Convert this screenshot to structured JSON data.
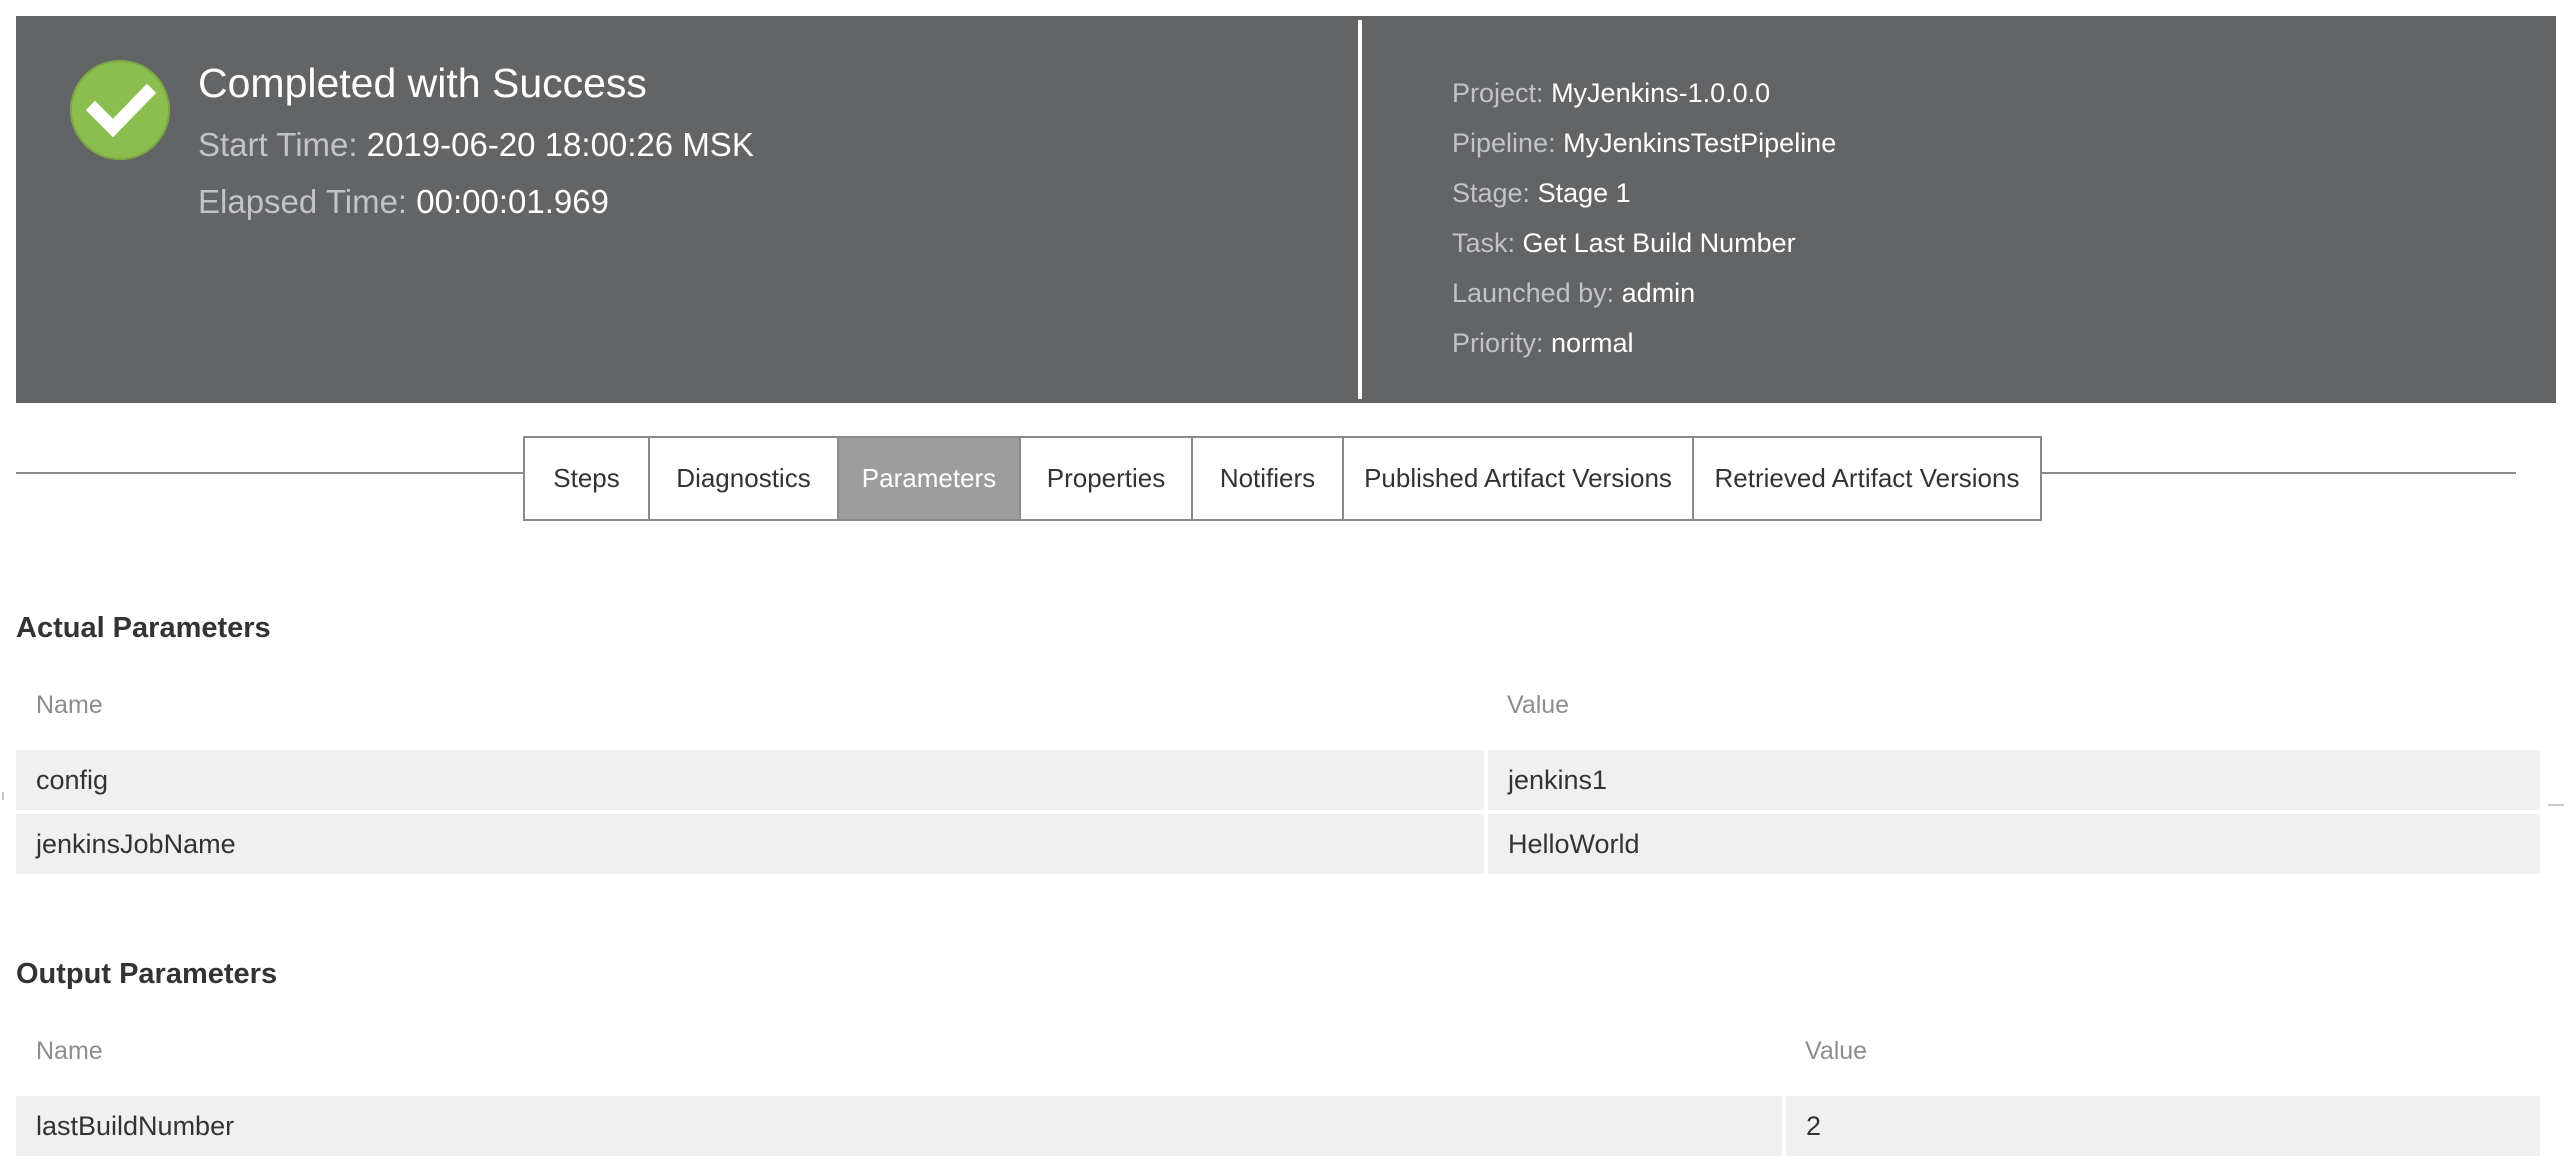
{
  "status": {
    "title": "Completed with Success",
    "start_label": "Start Time:",
    "start_value": "2019-06-20 18:00:26 MSK",
    "elapsed_label": "Elapsed Time:",
    "elapsed_value": "00:00:01.969",
    "icon": "checkmark-icon",
    "color": "#8cbd4f"
  },
  "info": {
    "project_label": "Project:",
    "project_value": "MyJenkins-1.0.0.0",
    "pipeline_label": "Pipeline:",
    "pipeline_value": "MyJenkinsTestPipeline",
    "stage_label": "Stage:",
    "stage_value": "Stage 1",
    "task_label": "Task:",
    "task_value": "Get Last Build Number",
    "launched_label": "Launched by:",
    "launched_value": "admin",
    "priority_label": "Priority:",
    "priority_value": "normal"
  },
  "tabs": [
    {
      "label": "Steps",
      "active": false
    },
    {
      "label": "Diagnostics",
      "active": false
    },
    {
      "label": "Parameters",
      "active": true
    },
    {
      "label": "Properties",
      "active": false
    },
    {
      "label": "Notifiers",
      "active": false
    },
    {
      "label": "Published Artifact Versions",
      "active": false
    },
    {
      "label": "Retrieved Artifact Versions",
      "active": false
    }
  ],
  "actual_parameters": {
    "title": "Actual Parameters",
    "col_name": "Name",
    "col_value": "Value",
    "rows": [
      {
        "name": "config",
        "value": "jenkins1"
      },
      {
        "name": "jenkinsJobName",
        "value": "HelloWorld"
      }
    ]
  },
  "output_parameters": {
    "title": "Output Parameters",
    "col_name": "Name",
    "col_value": "Value",
    "rows": [
      {
        "name": "lastBuildNumber",
        "value": "2"
      }
    ]
  },
  "colors": {
    "header_bg": "#636466",
    "active_tab_bg": "#9d9d9d",
    "row_bg": "#f0f0f0"
  }
}
